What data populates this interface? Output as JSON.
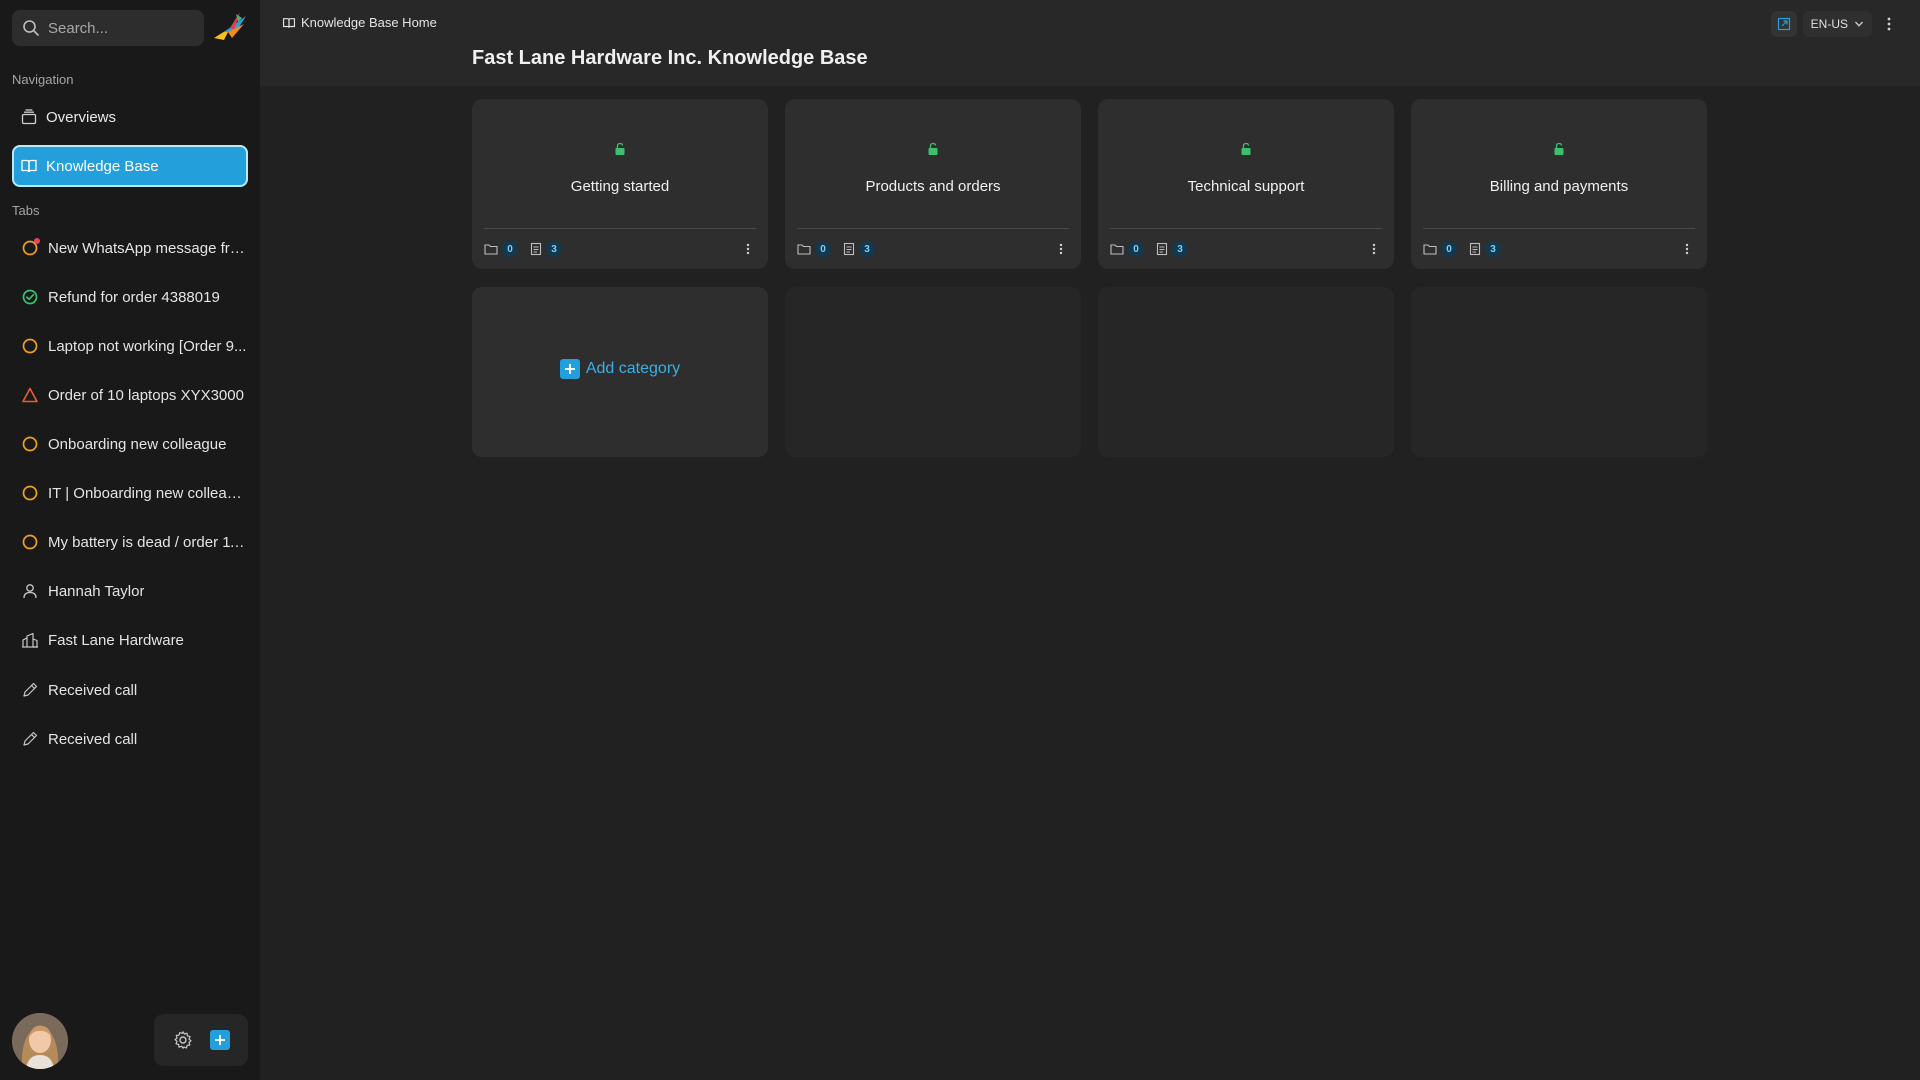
{
  "sidebar": {
    "search": {
      "placeholder": "Search..."
    },
    "navigation_label": "Navigation",
    "nav_items": [
      {
        "label": "Overviews",
        "icon": "layers-icon"
      },
      {
        "label": "Knowledge Base",
        "icon": "book-icon",
        "active": true
      }
    ],
    "tabs_label": "Tabs",
    "tabs": [
      {
        "label": "New WhatsApp message fro...",
        "icon": "circle-open-icon",
        "status_color": "#f0a020",
        "unread": true
      },
      {
        "label": "Refund for order 4388019",
        "icon": "check-circle-icon",
        "status_color": "#3cc070"
      },
      {
        "label": "Laptop not working [Order 9...",
        "icon": "circle-open-icon",
        "status_color": "#f0a020"
      },
      {
        "label": "Order of 10 laptops XYX3000",
        "icon": "warning-triangle-icon",
        "status_color": "#e8602c"
      },
      {
        "label": "Onboarding new colleague",
        "icon": "circle-open-icon",
        "status_color": "#f0a020"
      },
      {
        "label": "IT | Onboarding new colleague",
        "icon": "circle-open-icon",
        "status_color": "#f0a020"
      },
      {
        "label": "My battery is dead / order 11...",
        "icon": "circle-open-icon",
        "status_color": "#f0a020"
      },
      {
        "label": "Hannah Taylor",
        "icon": "user-icon"
      },
      {
        "label": "Fast Lane Hardware",
        "icon": "organization-icon"
      },
      {
        "label": "Received call",
        "icon": "pencil-icon"
      },
      {
        "label": "Received call",
        "icon": "pencil-icon"
      }
    ]
  },
  "header": {
    "breadcrumb": "Knowledge Base Home",
    "title": "Fast Lane Hardware Inc. Knowledge Base",
    "language": "EN-US"
  },
  "categories": [
    {
      "title": "Getting started",
      "folders": "0",
      "articles": "3"
    },
    {
      "title": "Products and orders",
      "folders": "0",
      "articles": "3"
    },
    {
      "title": "Technical support",
      "folders": "0",
      "articles": "3"
    },
    {
      "title": "Billing and payments",
      "folders": "0",
      "articles": "3"
    }
  ],
  "add_category_label": "Add category",
  "colors": {
    "accent": "#23a0db",
    "background": "#212121",
    "sidebar": "#191919",
    "unlock_icon": "#3cc070"
  }
}
